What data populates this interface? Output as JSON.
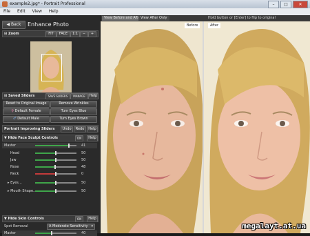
{
  "window": {
    "title": "example2.jpg* - Portrait Professional"
  },
  "menu": [
    "File",
    "Edit",
    "View",
    "Help"
  ],
  "nav": {
    "back_label": "Back",
    "section_title": "Enhance Photo"
  },
  "zoom": {
    "label": "Zoom",
    "fit": "FIT",
    "face": "FACE",
    "one_to_one": "1:1"
  },
  "saved_sliders": {
    "label": "Saved Sliders",
    "save": "SAVE SLIDERS",
    "manage": "MANAGE",
    "help": "Help",
    "buttons": [
      "Reset to Original Image",
      "Remove Wrinkles",
      "Default Female",
      "Turn Eyes Blue",
      "Default Male",
      "Turn Eyes Brown"
    ]
  },
  "portrait_sliders": {
    "label": "Portrait Improving Sliders",
    "undo": "Undo",
    "redo": "Redo",
    "help": "Help"
  },
  "face_sculpt": {
    "label": "Hide Face Sculpt Controls",
    "toggle": "ON",
    "help": "Help",
    "sliders": [
      {
        "label": "Master",
        "value": "41",
        "fraction": 0.82
      },
      {
        "label": "Head",
        "value": "50",
        "fraction": 0.5
      },
      {
        "label": "Jaw",
        "value": "50",
        "fraction": 0.5
      },
      {
        "label": "Nose",
        "value": "48",
        "fraction": 0.48
      },
      {
        "label": "Neck",
        "value": "0",
        "fraction": 0.5
      },
      {
        "label": "Eyes...",
        "value": "50",
        "fraction": 0.5
      },
      {
        "label": "Mouth Shape...",
        "value": "50",
        "fraction": 0.5
      }
    ]
  },
  "skin": {
    "label": "Hide Skin Controls",
    "toggle": "ON",
    "help": "Help",
    "spot_removal_label": "Spot Removal",
    "spot_removal_value": "A Moderate Sensitivity",
    "master_label": "Master",
    "master_value": "40",
    "master_fraction": 0.4
  },
  "view_tabs": [
    "View Before and After",
    "View After Only"
  ],
  "hint": "Hold button or [Enter] to flip to original",
  "before_label": "Before",
  "after_label": "After",
  "watermark": "megalayt.at.ua"
}
